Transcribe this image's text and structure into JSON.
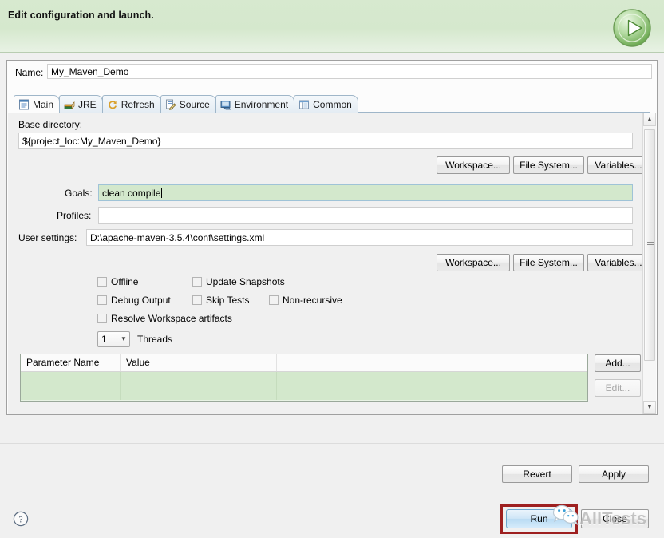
{
  "header": {
    "title": "Edit configuration and launch.",
    "run_icon": "play-circle-icon"
  },
  "name_row": {
    "label": "Name:",
    "value": "My_Maven_Demo"
  },
  "tabs": [
    {
      "label": "Main",
      "icon": "document-icon",
      "active": true
    },
    {
      "label": "JRE",
      "icon": "books-icon",
      "active": false
    },
    {
      "label": "Refresh",
      "icon": "refresh-icon",
      "active": false
    },
    {
      "label": "Source",
      "icon": "source-icon",
      "active": false
    },
    {
      "label": "Environment",
      "icon": "environment-icon",
      "active": false
    },
    {
      "label": "Common",
      "icon": "common-icon",
      "active": false
    }
  ],
  "main_tab": {
    "base_directory_label": "Base directory:",
    "base_directory_value": "${project_loc:My_Maven_Demo}",
    "base_buttons": [
      {
        "label": "Workspace..."
      },
      {
        "label": "File System..."
      },
      {
        "label": "Variables..."
      }
    ],
    "goals_label": "Goals:",
    "goals_value": "clean compile",
    "profiles_label": "Profiles:",
    "profiles_value": "",
    "user_settings_label": "User settings:",
    "user_settings_value": "D:\\apache-maven-3.5.4\\conf\\settings.xml",
    "settings_buttons": [
      {
        "label": "Workspace..."
      },
      {
        "label": "File System..."
      },
      {
        "label": "Variables..."
      }
    ],
    "checkboxes": [
      {
        "label": "Offline",
        "checked": false
      },
      {
        "label": "Update Snapshots",
        "checked": false
      },
      {
        "label": "Debug Output",
        "checked": false
      },
      {
        "label": "Skip Tests",
        "checked": false
      },
      {
        "label": "Non-recursive",
        "checked": false
      },
      {
        "label": "Resolve Workspace artifacts",
        "checked": false
      }
    ],
    "threads": {
      "value": "1",
      "label": "Threads"
    },
    "parameters_table": {
      "columns": [
        "Parameter Name",
        "Value",
        ""
      ],
      "rows": [
        [
          "",
          "",
          ""
        ],
        [
          "",
          "",
          ""
        ]
      ]
    },
    "table_buttons": [
      {
        "label": "Add...",
        "enabled": true
      },
      {
        "label": "Edit...",
        "enabled": false
      }
    ]
  },
  "footer": {
    "revert_label": "Revert",
    "apply_label": "Apply",
    "run_label": "Run",
    "close_label": "Close",
    "help_icon": "help-question-icon"
  },
  "watermark": {
    "text": "AllTests",
    "logo": "wechat-logo-icon"
  },
  "colors": {
    "header_green": "#d5e8cd",
    "highlight_red": "#9e2020",
    "field_green": "#d3e8cc",
    "run_blue": "#cfe6f7"
  }
}
